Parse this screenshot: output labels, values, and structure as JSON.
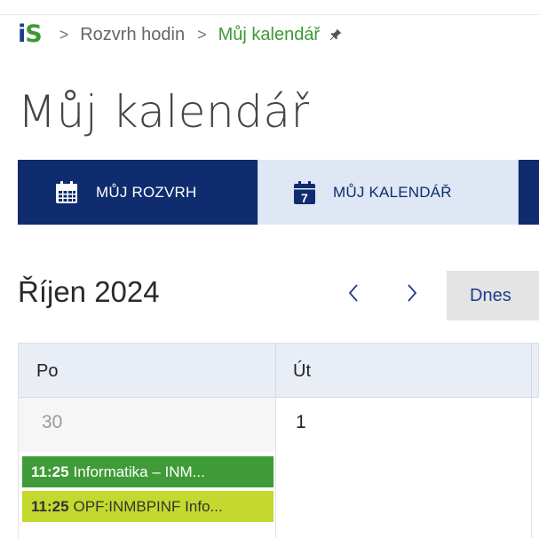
{
  "breadcrumb": {
    "logo_i": "i",
    "logo_s": "S",
    "separator": ">",
    "items": [
      "Rozvrh hodin",
      "Můj kalendář"
    ]
  },
  "page": {
    "title": "Můj kalendář"
  },
  "tabs": [
    {
      "label": "MŮJ ROZVRH",
      "icon": "calendar-grid-icon",
      "active": false
    },
    {
      "label": "MŮJ KALENDÁŘ",
      "icon": "calendar-day-icon",
      "icon_text": "7",
      "active": true
    }
  ],
  "calendar": {
    "month_label": "Říjen 2024",
    "prev_symbol": "‹",
    "next_symbol": "›",
    "today_label": "Dnes",
    "day_headers": [
      "Po",
      "Út"
    ],
    "dates": [
      "30",
      "1"
    ],
    "events": [
      {
        "time": "11:25",
        "title": "Informatika – INM...",
        "color": "#3f9b37"
      },
      {
        "time": "11:25",
        "title": "OPF:INMBPINF Info...",
        "color": "#c3d92e"
      }
    ]
  },
  "colors": {
    "brand_navy": "#0f2c6e",
    "brand_green": "#3a9a35",
    "tab_active_bg": "#dfe7f5"
  }
}
